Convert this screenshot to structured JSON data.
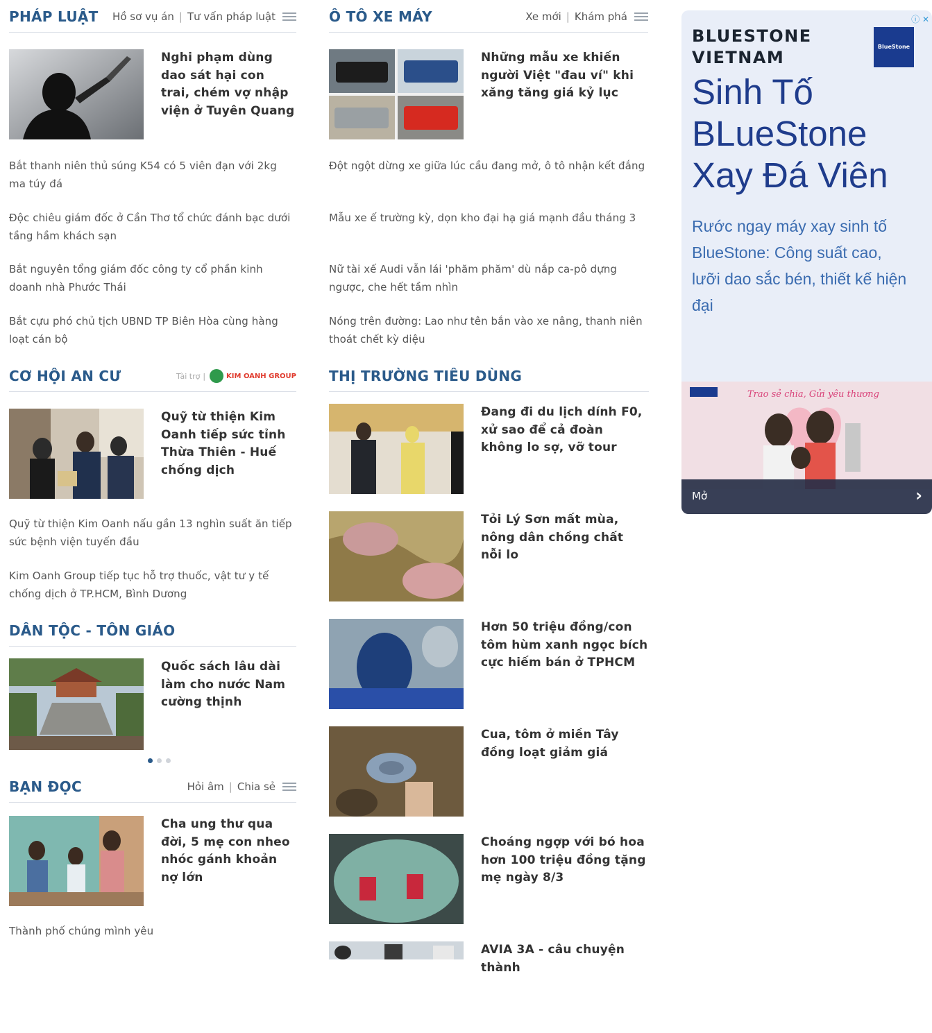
{
  "phap_luat": {
    "title": "PHÁP LUẬT",
    "links": [
      "Hồ sơ vụ án",
      "Tư vấn pháp luật"
    ],
    "featured_title": "Nghi phạm dùng dao sát hại con trai, chém vợ nhập viện ở Tuyên Quang",
    "items": [
      "Bắt thanh niên thủ súng K54 có 5 viên đạn với 2kg ma túy đá",
      "Độc chiêu giám đốc ở Cần Thơ tổ chức đánh bạc dưới tầng hầm khách sạn",
      "Bắt nguyên tổng giám đốc công ty cổ phần kinh doanh nhà Phước Thái",
      "Bắt cựu phó chủ tịch UBND TP Biên Hòa cùng hàng loạt cán bộ"
    ]
  },
  "oto": {
    "title": "Ô TÔ XE MÁY",
    "links": [
      "Xe mới",
      "Khám phá"
    ],
    "featured_title": "Những mẫu xe khiến người Việt \"đau ví\" khi xăng tăng giá kỷ lục",
    "items": [
      "Đột ngột dừng xe giữa lúc cầu đang mở, ô tô nhận kết đắng",
      "Mẫu xe ế trường kỳ, dọn kho đại hạ giá mạnh đầu tháng 3",
      "Nữ tài xế Audi vẫn lái 'phăm phăm' dù nắp ca-pô dựng ngược, che hết tầm nhìn",
      "Nóng trên đường: Lao như tên bắn vào xe nâng, thanh niên thoát chết kỳ diệu"
    ]
  },
  "co_hoi": {
    "title": "CƠ HỘI AN CƯ",
    "sponsor_label": "Tài trợ",
    "sponsor_logo": "KIM OANH GROUP",
    "featured_title": "Quỹ từ thiện Kim Oanh tiếp sức tỉnh Thừa Thiên - Huế chống dịch",
    "items": [
      "Quỹ từ thiện Kim Oanh nấu gần 13 nghìn suất ăn tiếp sức bệnh viện tuyến đầu",
      "Kim Oanh Group tiếp tục hỗ trợ thuốc, vật tư y tế chống dịch ở TP.HCM, Bình Dương"
    ]
  },
  "thi_truong": {
    "title": "THỊ TRƯỜNG TIÊU DÙNG",
    "articles": [
      "Đang đi du lịch dính F0, xử sao để cả đoàn không lo sợ, vỡ tour",
      "Tỏi Lý Sơn mất mùa, nông dân chồng chất nỗi lo",
      "Hơn 50 triệu đồng/con tôm hùm xanh ngọc bích cực hiếm bán ở TPHCM",
      "Cua, tôm ở miền Tây đồng loạt giảm giá",
      "Choáng ngợp với bó hoa hơn 100 triệu đồng tặng mẹ ngày 8/3",
      "AVIA 3A - câu chuyện thành"
    ]
  },
  "dan_toc": {
    "title": "DÂN TỘC - TÔN GIÁO",
    "featured_title": "Quốc sách lâu dài làm cho nước Nam cường thịnh"
  },
  "ban_doc": {
    "title": "BẠN ĐỌC",
    "links": [
      "Hỏi âm",
      "Chia sẻ"
    ],
    "featured_title": "Cha ung thư qua đời, 5 mẹ con nheo nhóc gánh khoản nợ lớn",
    "items": [
      "Thành phố chúng mình yêu"
    ]
  },
  "ad": {
    "close_icons": "ⓘ ✕",
    "brand": "BLUESTONE VIETNAM",
    "logo_text": "BlueStone",
    "headline": "Sinh Tố BLueStone Xay Đá Viên",
    "body": "Rước ngay máy xay sinh tố BlueStone: Công suất cao, lưỡi dao sắc bén, thiết kế hiện đại",
    "image_caption": "Trao sẻ chia, Gửi yêu thương",
    "button_label": "Mở",
    "accent_color": "#1f3c8c"
  },
  "icons": [
    "hamburger-menu-icon",
    "chevron-right-icon",
    "info-icon",
    "close-icon"
  ]
}
